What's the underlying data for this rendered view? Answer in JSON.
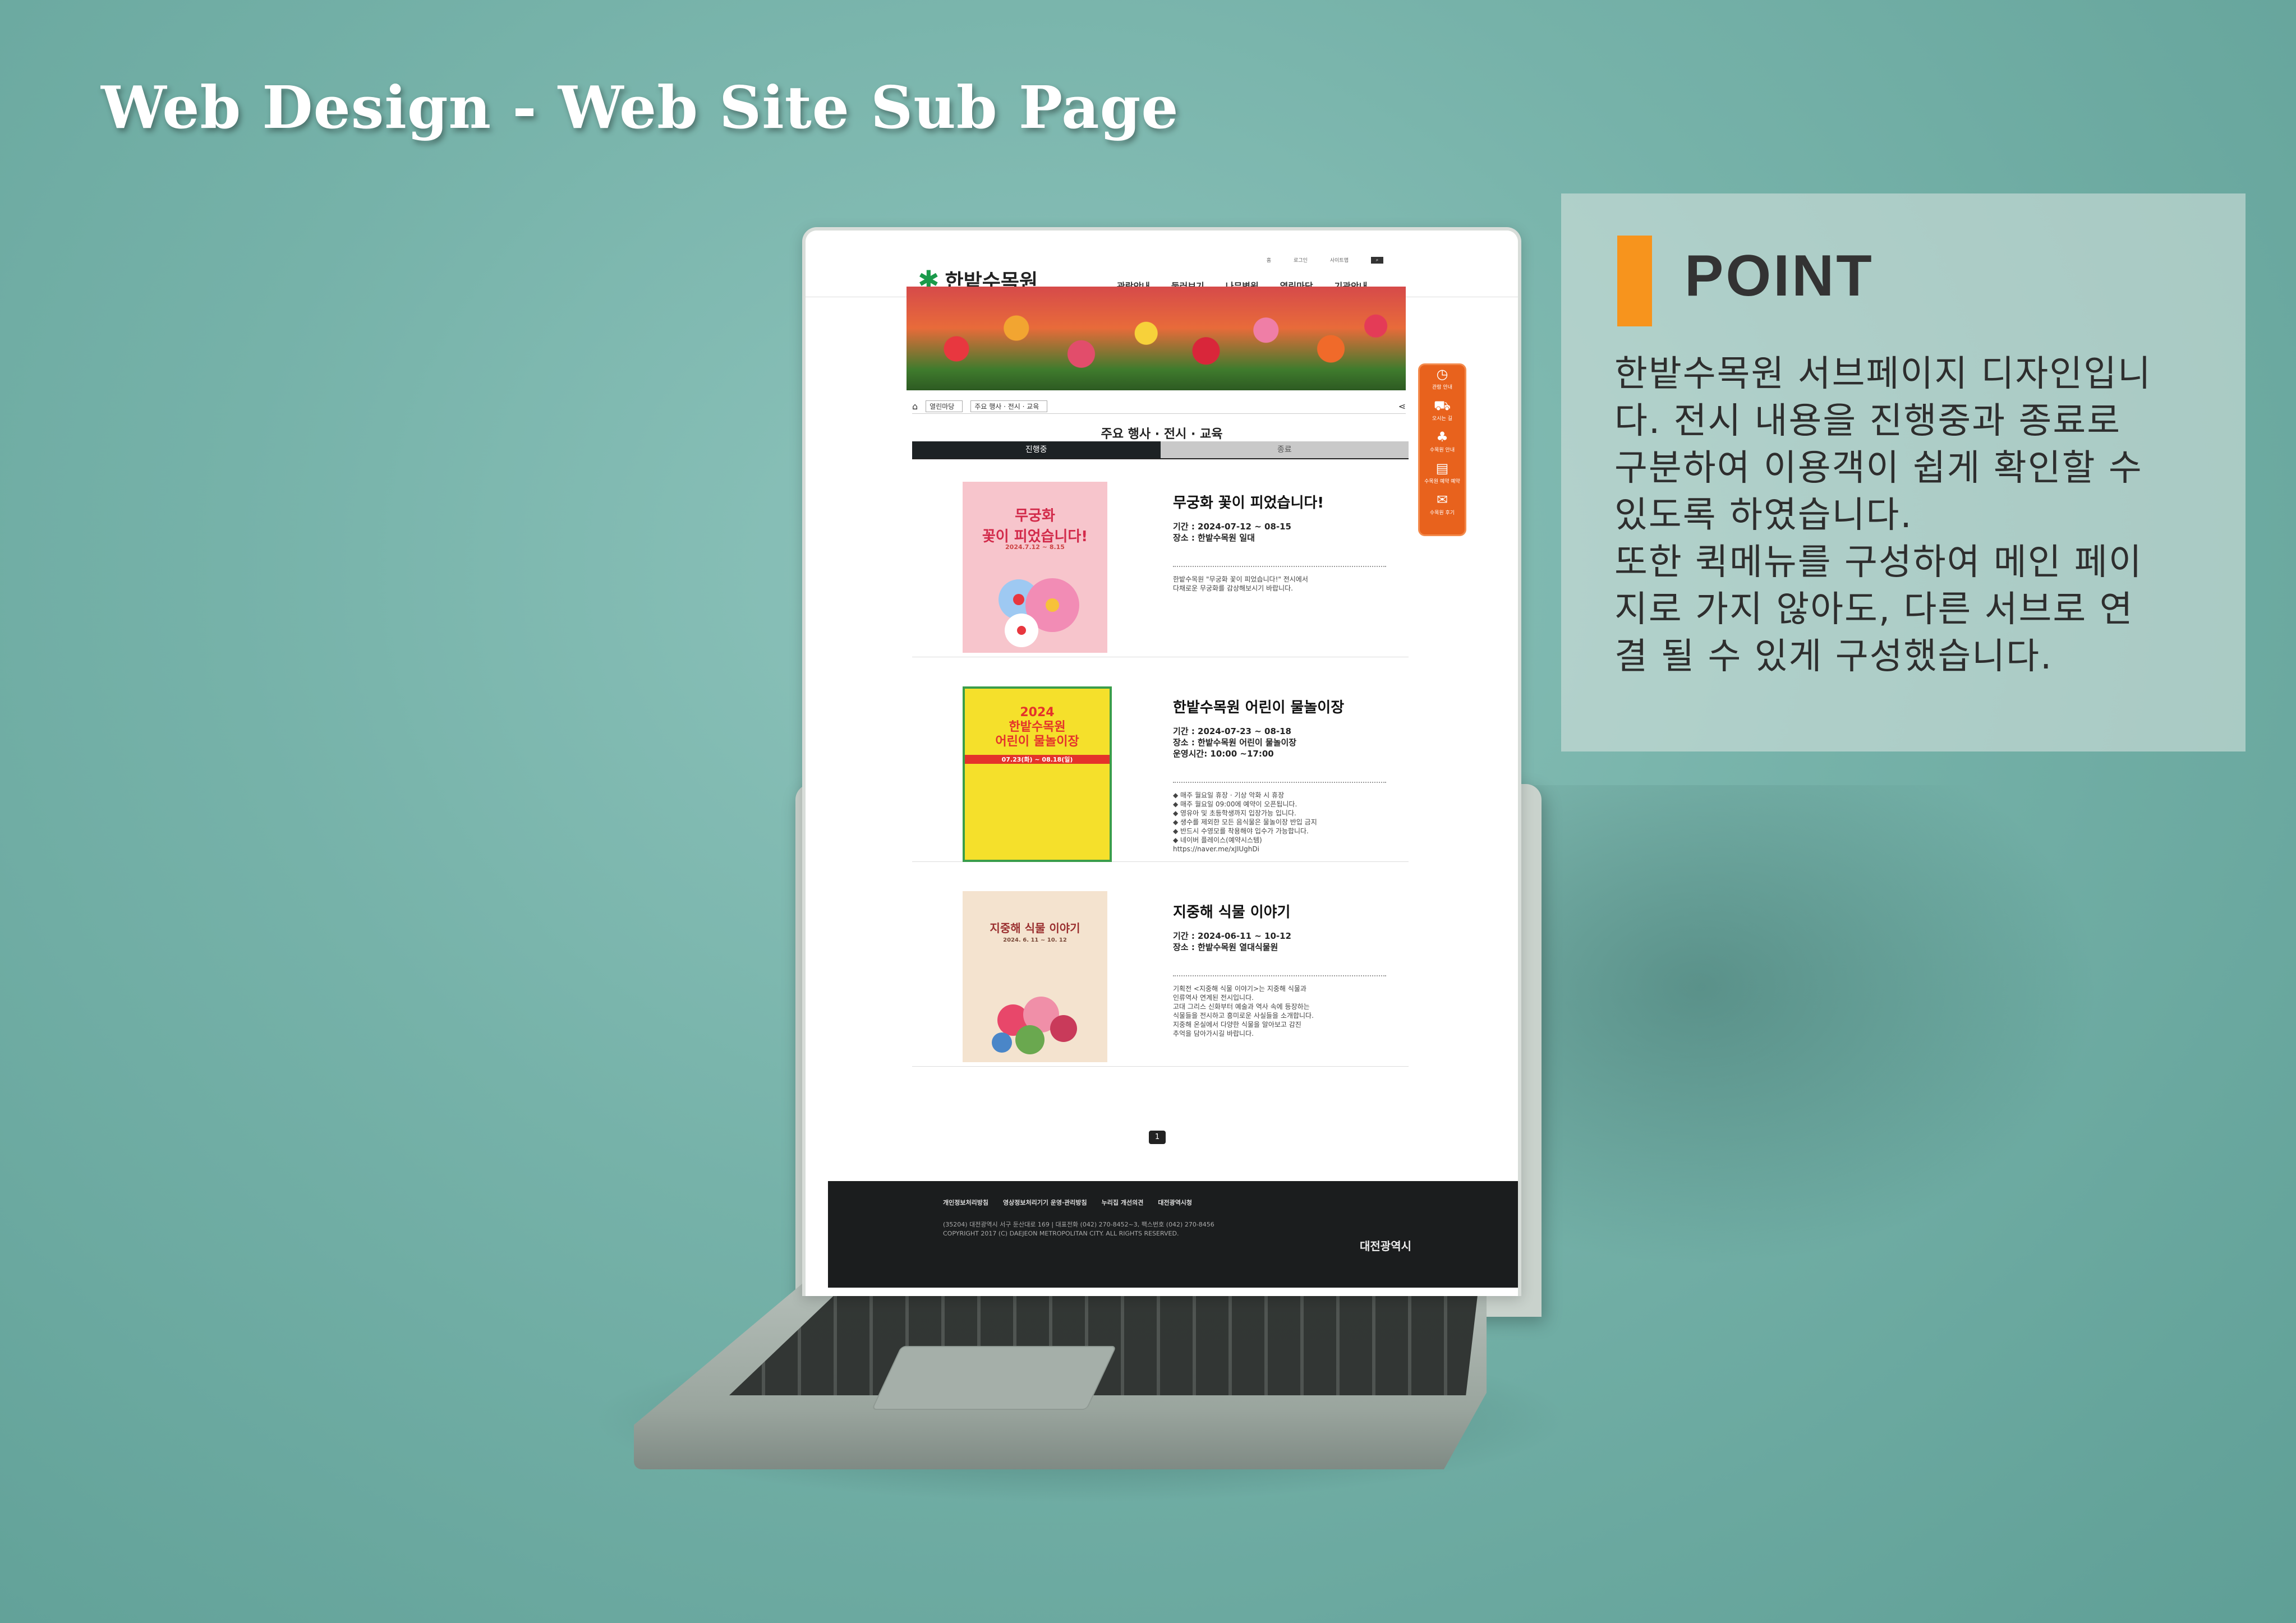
{
  "title": "Web Design - Web Site Sub Page",
  "point": {
    "heading": "POINT",
    "lines": [
      "한밭수목원 서브페이지 디자인입니",
      "다. 전시 내용을 진행중과 종료로",
      "구분하여 이용객이 쉽게 확인할 수",
      "있도록 하였습니다.",
      "또한 퀵메뉴를 구성하여 메인 페이",
      "지로 가지 않아도, 다른 서브로 연",
      "결 될 수 있게 구성했습니다."
    ]
  },
  "site": {
    "logo": "한밭수목원",
    "util": [
      "홈",
      "로그인",
      "사이트맵"
    ],
    "gnb": [
      "관람안내",
      "둘러보기",
      "나무병원",
      "열린마당",
      "기관안내"
    ],
    "crumb": [
      "열린마당",
      "주요 행사 · 전시 · 교육"
    ],
    "sub_title": "주요 행사 · 전시 · 교육",
    "tabs": [
      "진행중",
      "종료"
    ],
    "events": [
      {
        "title": "무궁화 꽃이 피었습니다!",
        "meta": "기간 : 2024-07-12 ~ 08-15\n장소 : 한밭수목원 일대",
        "desc": "한밭수목원 \"무궁화 꽃이 피었습니다!\" 전시에서\n다채로운 무궁화를 감상해보시기 바랍니다.",
        "poster_title": "무궁화\n꽃이 피었습니다!",
        "poster_date": "2024.7.12 ~ 8.15"
      },
      {
        "title": "한밭수목원 어린이 물놀이장",
        "meta": "기간 : 2024-07-23 ~ 08-18\n장소 : 한밭수목원 어린이 물놀이장\n운영시간: 10:00 ~17:00",
        "desc": "◆ 매주 월요일 휴장 · 기상 악화 시 휴장\n◆ 매주 월요일 09:00에 예약이 오픈됩니다.\n◆ 영유아 및 초등학생까지 입장가능 입니다.\n◆ 생수를 제외한 모든 음식물은 물놀이장 반입 금지\n◆ 반드시 수영모를 착용해야 입수가 가능합니다.\n◆ 네이버 플레이스(예약시스템)\n   https://naver.me/xJIUghDi",
        "poster_title": "2024\n한밭수목원\n어린이 물놀이장",
        "poster_date": "07.23(화) ~ 08.18(일)"
      },
      {
        "title": "지중해 식물 이야기",
        "meta": "기간 : 2024-06-11 ~ 10-12\n장소 : 한밭수목원 열대식물원",
        "desc": "기획전 <지중해 식물 이야기>는 지중해 식물과\n인류역사 연계된 전시입니다.\n고대 그리스 신화부터 예술과 역사 속에 등장하는\n식물들을 전시하고 흥미로운 사실들을 소개합니다.\n지중해 온실에서 다양한 식물을 알아보고 감진\n추억을 담아가시길 바랍니다.",
        "poster_title": "지중해 식물 이야기",
        "poster_date": "2024. 6. 11 ~ 10. 12"
      }
    ],
    "page": "1",
    "footer_links": [
      "개인정보처리방침",
      "영상정보처리기기 운영·관리방침",
      "누리집 개선의견",
      "대전광역시청"
    ],
    "footer_addr": "(35204) 대전광역시 서구 둔산대로 169  |  대표전화 (042) 270-8452~3, 팩스번호 (042) 270-8456\nCOPYRIGHT 2017 (C) DAEJEON METROPOLITAN CITY. ALL RIGHTS RESERVED.",
    "footer_city": "대전광역시",
    "quick": [
      "관람 안내",
      "오시는 길",
      "수목원 안내",
      "수목원 예약 예약",
      "수목원 후기"
    ]
  },
  "colors": {
    "accent": "#f7941d",
    "quick": "#e8621d",
    "brand_green": "#1a9a4a"
  }
}
